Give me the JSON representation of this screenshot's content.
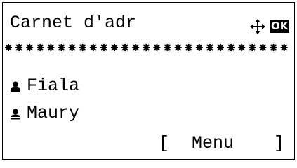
{
  "screen": {
    "title": "Carnet d'adr",
    "ok_label": "OK",
    "nav_icon": "four-way-arrow-icon"
  },
  "divider": {
    "pattern": "asterisk-dots"
  },
  "list": {
    "items": [
      {
        "label": "Fiala",
        "icon": "person-icon"
      },
      {
        "label": "Maury",
        "icon": "person-icon"
      }
    ]
  },
  "softkey": {
    "open_bracket": "[",
    "label": "Menu",
    "close_bracket": "]"
  }
}
